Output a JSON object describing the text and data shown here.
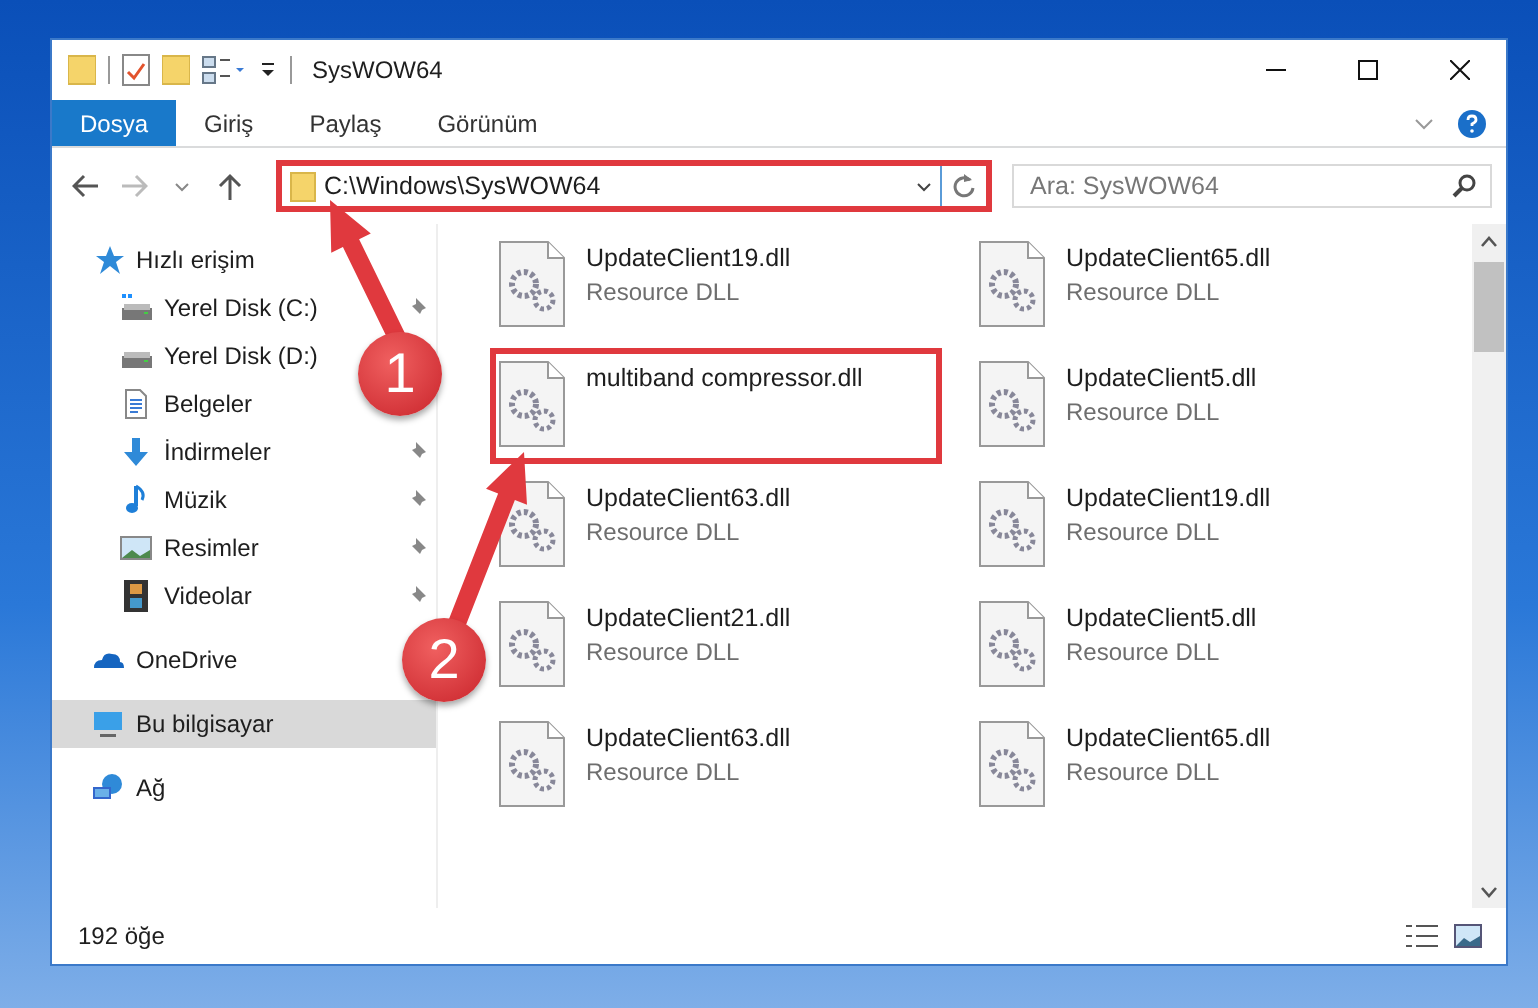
{
  "window": {
    "title": "SysWOW64"
  },
  "ribbon_tabs": [
    {
      "label": "Dosya",
      "selected": true
    },
    {
      "label": "Giriş",
      "selected": false
    },
    {
      "label": "Paylaş",
      "selected": false
    },
    {
      "label": "Görünüm",
      "selected": false
    }
  ],
  "address": {
    "path": "C:\\Windows\\SysWOW64",
    "highlighted": true
  },
  "search": {
    "placeholder": "Ara: SysWOW64"
  },
  "nav": [
    {
      "label": "Hızlı erişim",
      "kind": "star",
      "pinned": false,
      "selected": false,
      "children": [
        {
          "label": "Yerel Disk (C:)",
          "kind": "drive-c",
          "pinned": true,
          "selected": false
        },
        {
          "label": "Yerel Disk (D:)",
          "kind": "drive",
          "pinned": false,
          "selected": false
        },
        {
          "label": "Belgeler",
          "kind": "document",
          "pinned": false,
          "selected": false
        },
        {
          "label": "İndirmeler",
          "kind": "download",
          "pinned": true,
          "selected": false
        },
        {
          "label": "Müzik",
          "kind": "music",
          "pinned": true,
          "selected": false
        },
        {
          "label": "Resimler",
          "kind": "picture",
          "pinned": true,
          "selected": false
        },
        {
          "label": "Videolar",
          "kind": "film",
          "pinned": true,
          "selected": false
        }
      ]
    },
    {
      "label": "OneDrive",
      "kind": "cloud",
      "pinned": false,
      "selected": false
    },
    {
      "label": "Bu bilgisayar",
      "kind": "computer",
      "pinned": false,
      "selected": true
    },
    {
      "label": "Ağ",
      "kind": "network",
      "pinned": false,
      "selected": false
    }
  ],
  "files": [
    {
      "name": "UpdateClient19.dll",
      "type": "Resource DLL",
      "highlighted": false
    },
    {
      "name": "UpdateClient65.dll",
      "type": "Resource DLL",
      "highlighted": false
    },
    {
      "name": "multiband compressor.dll",
      "highlighted": true
    },
    {
      "name": "UpdateClient5.dll",
      "type": "Resource DLL",
      "highlighted": false
    },
    {
      "name": "UpdateClient63.dll",
      "type": "Resource DLL",
      "highlighted": false
    },
    {
      "name": "UpdateClient19.dll",
      "type": "Resource DLL",
      "highlighted": false
    },
    {
      "name": "UpdateClient21.dll",
      "type": "Resource DLL",
      "highlighted": false
    },
    {
      "name": "UpdateClient5.dll",
      "type": "Resource DLL",
      "highlighted": false
    },
    {
      "name": "UpdateClient63.dll",
      "type": "Resource DLL",
      "highlighted": false
    },
    {
      "name": "UpdateClient65.dll",
      "type": "Resource DLL",
      "highlighted": false
    }
  ],
  "status_bar": {
    "count": "192 öğe"
  },
  "annotations": [
    {
      "label": "1"
    },
    {
      "label": "2"
    }
  ]
}
